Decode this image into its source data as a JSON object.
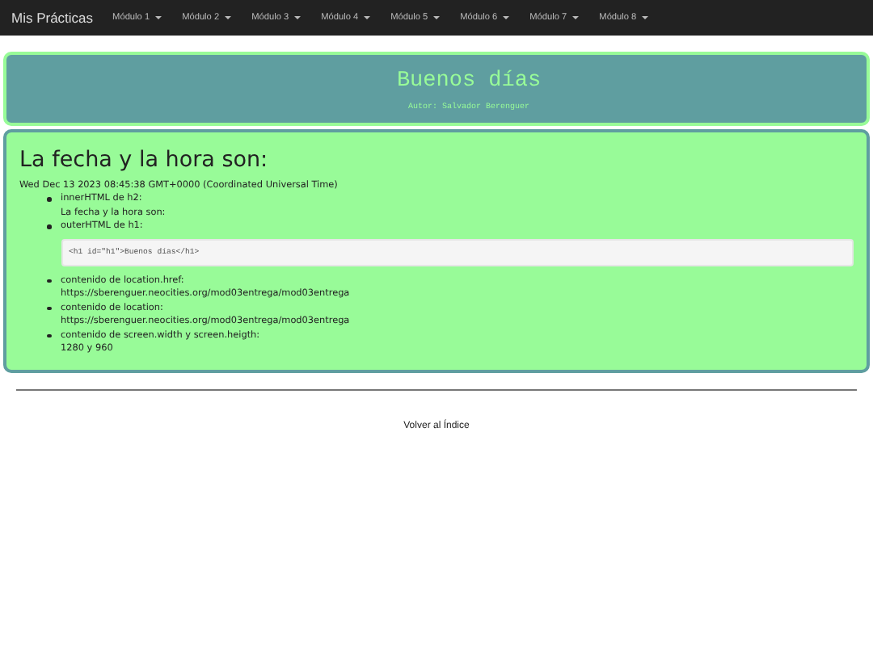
{
  "navbar": {
    "brand": "Mis Prácticas",
    "menus": [
      "Módulo 1",
      "Módulo 2",
      "Módulo 3",
      "Módulo 4",
      "Módulo 5",
      "Módulo 6",
      "Módulo 7",
      "Módulo 8"
    ]
  },
  "header": {
    "title": "Buenos días",
    "author": "Autor: Salvador Berenguer"
  },
  "content": {
    "heading": "La fecha y la hora son:",
    "date": "Wed Dec 13 2023 08:45:38 GMT+0000 (Coordinated Universal Time)",
    "items": [
      {
        "label": "innerHTML de h2:",
        "kind": "text",
        "value": "La fecha y la hora son:"
      },
      {
        "label": "outerHTML de h1:",
        "kind": "code",
        "value": "<h1 id=\"h1\">Buenos días</h1>"
      },
      {
        "label": "contenido de location.href:",
        "kind": "text",
        "value": "https://sberenguer.neocities.org/mod03entrega/mod03entrega"
      },
      {
        "label": "contenido de location:",
        "kind": "text",
        "value": "https://sberenguer.neocities.org/mod03entrega/mod03entrega"
      },
      {
        "label": "contenido de screen.width y screen.heigth:",
        "kind": "text",
        "value": "1280 y 960"
      }
    ]
  },
  "footer_link": "Volver al Índice"
}
